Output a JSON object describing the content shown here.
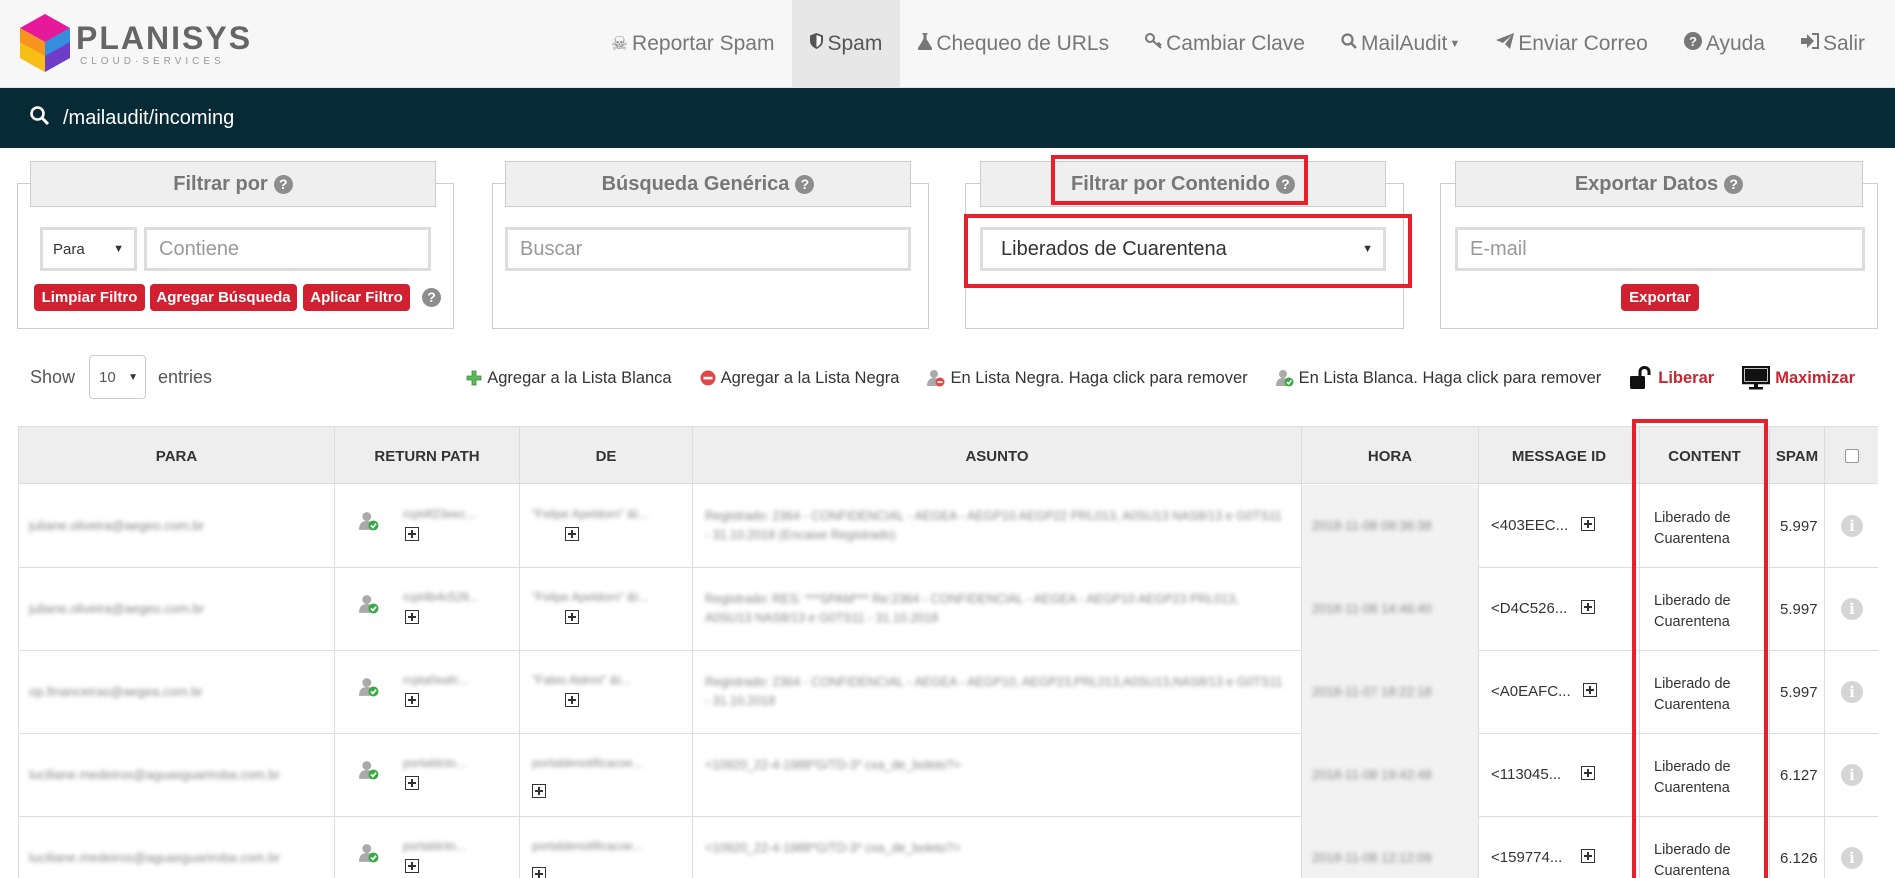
{
  "brand": {
    "name": "PLANISYS",
    "tagline": "CLOUD·SERVICES"
  },
  "nav": {
    "items": [
      {
        "label": "Reportar Spam",
        "icon": "skull-crossbones-icon"
      },
      {
        "label": "Spam",
        "icon": "shield-icon",
        "active": true
      },
      {
        "label": "Chequeo de URLs",
        "icon": "flask-icon"
      },
      {
        "label": "Cambiar Clave",
        "icon": "key-icon"
      },
      {
        "label": "MailAudit",
        "icon": "search-icon",
        "dropdown": true
      },
      {
        "label": "Enviar Correo",
        "icon": "paper-plane-icon"
      },
      {
        "label": "Ayuda",
        "icon": "question-circle-icon"
      },
      {
        "label": "Salir",
        "icon": "sign-out-icon"
      }
    ]
  },
  "path": "/mailaudit/incoming",
  "filters": {
    "filtrar_por": {
      "title": "Filtrar por",
      "select_value": "Para",
      "input_placeholder": "Contiene",
      "buttons": [
        "Limpiar Filtro",
        "Agregar Búsqueda",
        "Aplicar Filtro"
      ]
    },
    "busqueda": {
      "title": "Búsqueda Genérica",
      "input_placeholder": "Buscar"
    },
    "contenido": {
      "title": "Filtrar por Contenido",
      "select_value": "Liberados de Cuarentena"
    },
    "exportar": {
      "title": "Exportar Datos",
      "input_placeholder": "E-mail",
      "button": "Exportar"
    }
  },
  "show": {
    "label": "Show",
    "value": "10",
    "suffix": "entries"
  },
  "legend": {
    "whitelist_add": "Agregar a la Lista Blanca",
    "blacklist_add": "Agregar a la Lista Negra",
    "in_blacklist": "En Lista Negra. Haga click para remover",
    "in_whitelist": "En Lista Blanca. Haga click para remover",
    "release": "Liberar",
    "maximize": "Maximizar"
  },
  "table": {
    "headers": [
      "PARA",
      "RETURN PATH",
      "DE",
      "ASUNTO",
      "HORA",
      "MESSAGE ID",
      "CONTENT",
      "SPAM"
    ],
    "rows": [
      {
        "para": "juliane.oliveira@aegeo.com.br",
        "rp": "rcpt4f23eec...",
        "de": "\"Felipe Apeldorn\" &l...",
        "asunto": "Registrado: 2364 - CONFIDENCIAL - AEGEA - AEGP10 AEGP22 PRL013, A0SU13 NAS8/13 e G0TS11 - 31.10.2018 (Encaixe Registrado)",
        "hora": "2018-11-08 09:36:38",
        "message_id": "<403EEC...",
        "content": "Liberado de Cuarentena",
        "spam": "5.997"
      },
      {
        "para": "juliane.oliveira@aegeo.com.br",
        "rp": "rcpt4b4c526...",
        "de": "\"Felipe Apeldorn\" &l...",
        "asunto": "Registrado: RES: ***SPAM*** Re:2364 - CONFIDENCIAL - AEGEA - AEGP10 AEGP23 PRL013, A0SU13 NAS8/13 e G0TS11 - 31.10.2018",
        "hora": "2018-11-08 14:46:40",
        "message_id": "<D4C526...",
        "content": "Liberado de Cuarentena",
        "spam": "5.997"
      },
      {
        "para": "op.financeiras@aegea.com.br",
        "rp": "rcpta0eafc...",
        "de": "\"Fabio Aldrini\" &l...",
        "asunto": "Registrado: 2364 - CONFIDENCIAL - AEGEA - AEGP10, AEGP23,PRL013,A0SU13,NAS8/13 e G0TS11 - 31.10.2018",
        "hora": "2018-11-07 18:22:18",
        "message_id": "<A0EAFC...",
        "content": "Liberado de Cuarentena",
        "spam": "5.997"
      },
      {
        "para": "luciliane.medeiros@aguasguariroba.com.br",
        "rp": "portaldcto...",
        "de": "portaldenotificacoe...",
        "asunto": "<10920_22-4-1988*G/TD-3* cxa_de_boleto?>",
        "hora": "2018-11-08 19:42:48",
        "message_id": "<113045...",
        "content": "Liberado de Cuarentena",
        "spam": "6.127"
      },
      {
        "para": "luciliane.medeiros@aguasguariroba.com.br",
        "rp": "portaldcto...",
        "de": "portaldenotificacoe...",
        "asunto": "<10920_22-4-1988*G/TD-3* cxa_de_boleto?>",
        "hora": "2018-11-08 12:12:09",
        "message_id": "<159774...",
        "content": "Liberado de Cuarentena",
        "spam": "6.126"
      }
    ]
  }
}
